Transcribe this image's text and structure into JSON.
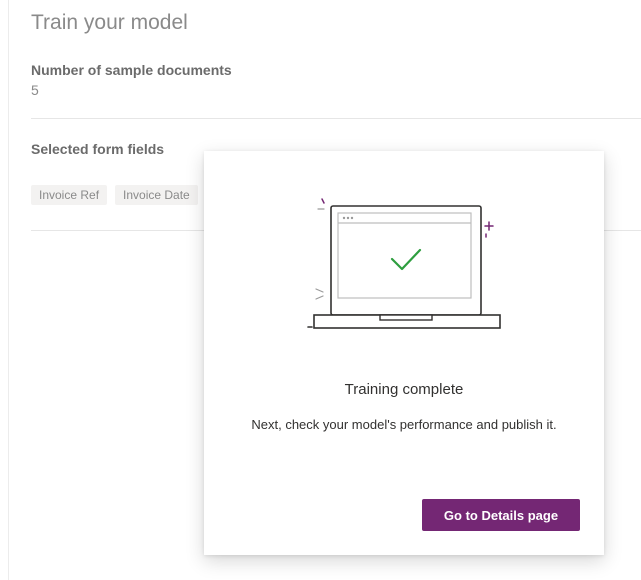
{
  "page": {
    "title": "Train your model",
    "sample_docs_label": "Number of sample documents",
    "sample_docs_value": "5",
    "selected_fields_label": "Selected form fields",
    "tags": [
      "Invoice Ref",
      "Invoice Date"
    ]
  },
  "dialog": {
    "illustration_icon": "laptop-checkmark-icon",
    "title": "Training complete",
    "message": "Next, check your model's performance and publish it.",
    "button_label": "Go to Details page"
  },
  "colors": {
    "accent": "#742774",
    "check": "#2e9e3f"
  }
}
